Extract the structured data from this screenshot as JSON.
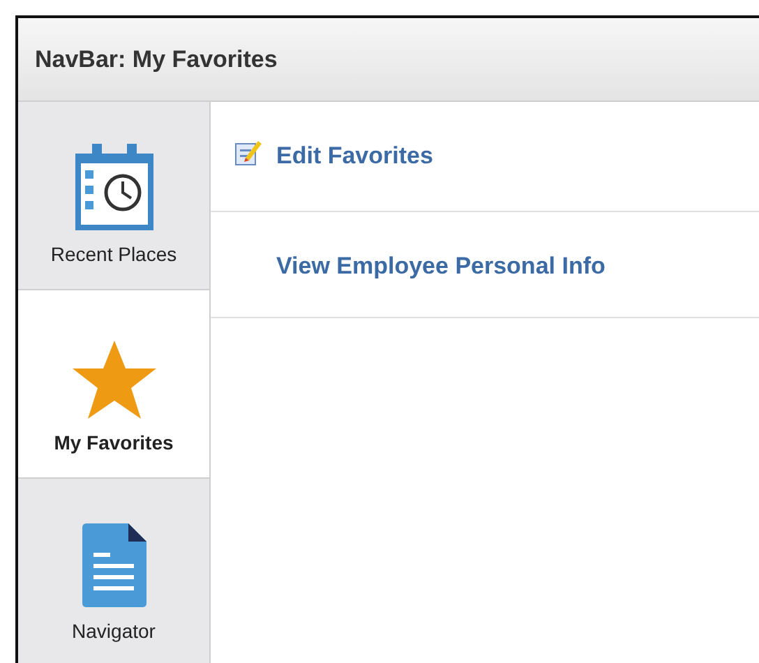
{
  "window": {
    "title": "NavBar: My Favorites"
  },
  "sidebar": {
    "items": [
      {
        "label": "Recent Places",
        "kind": "recent",
        "selected": false
      },
      {
        "label": "My Favorites",
        "kind": "favorites",
        "selected": true
      },
      {
        "label": "Navigator",
        "kind": "navigator",
        "selected": false
      }
    ]
  },
  "links": [
    {
      "label": "Edit Favorites",
      "kind": "edit"
    },
    {
      "label": "View Employee Personal Info",
      "kind": "plain"
    }
  ]
}
